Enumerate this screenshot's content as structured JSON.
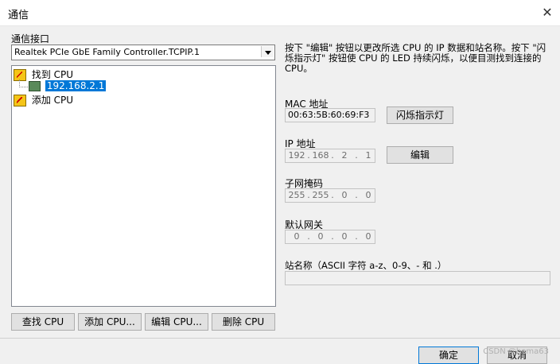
{
  "window": {
    "title": "通信",
    "close_icon": "close-icon"
  },
  "left": {
    "interface_label": "通信接口",
    "interface_value": "Realtek PCIe GbE Family Controller.TCPIP.1",
    "tree": {
      "found_cpu": "找到 CPU",
      "device_ip": "192.168.2.1",
      "add_cpu": "添加 CPU"
    },
    "buttons": {
      "find": "查找 CPU",
      "add": "添加 CPU...",
      "edit": "编辑 CPU...",
      "delete": "删除 CPU"
    }
  },
  "right": {
    "description": "按下 \"编辑\" 按钮以更改所选 CPU 的 IP 数据和站名称。按下 \"闪烁指示灯\" 按钮使 CPU 的 LED 持续闪烁，以便目测找到连接的 CPU。",
    "mac_label": "MAC 地址",
    "mac_value": "00:63:5B:60:69:F3",
    "flash_button": "闪烁指示灯",
    "ip_label": "IP 地址",
    "ip": [
      "192",
      "168",
      "2",
      "1"
    ],
    "edit_button": "编辑",
    "subnet_label": "子网掩码",
    "subnet": [
      "255",
      "255",
      "0",
      "0"
    ],
    "gateway_label": "默认网关",
    "gateway": [
      "0",
      "0",
      "0",
      "0"
    ],
    "station_label": "站名称（ASCII 字符 a-z、0-9、- 和 .）",
    "station_value": ""
  },
  "footer": {
    "ok": "确定",
    "cancel": "取消",
    "watermark": "CSDN @hema63"
  },
  "colors": {
    "selection": "#0078d7",
    "background": "#f0f0f0",
    "cpu_icon": "#f5c518"
  }
}
